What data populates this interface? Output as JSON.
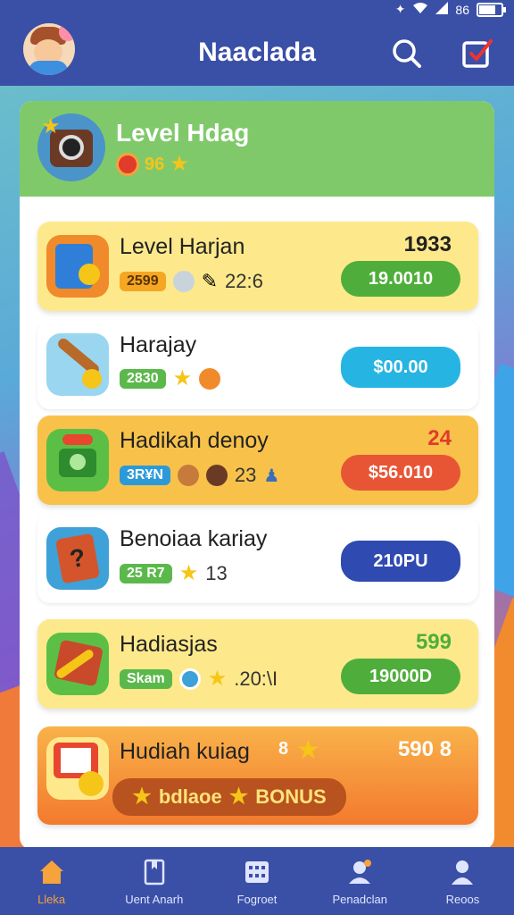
{
  "status": {
    "clock": "86",
    "battery_level": 0.8
  },
  "app": {
    "title": "Naaclada"
  },
  "header_card": {
    "title": "Level Hdag",
    "value": "96"
  },
  "rows": [
    {
      "title": "Level Harjan",
      "tag": "2599",
      "meta": "22:6",
      "extra": "1933",
      "button": "19.0010",
      "style": "yellow"
    },
    {
      "title": "Harajay",
      "tag": "2830",
      "meta": "",
      "extra": "",
      "button": "$00.00",
      "style": "white"
    },
    {
      "title": "Hadikah denoy",
      "tag": "3R¥N",
      "meta": "23",
      "extra": "24",
      "button": "$56.010",
      "style": "orange"
    },
    {
      "title": "Benoiaa kariay",
      "tag": "25 R7",
      "meta": "13",
      "extra": "",
      "button": "210PU",
      "style": "white"
    },
    {
      "title": "Hadiasjas",
      "tag": "Skam",
      "meta": ".20:\\I",
      "extra": "599",
      "button": "19000D",
      "style": "yellow"
    },
    {
      "title": "Hudiah kuiag",
      "tag": "8",
      "meta": "",
      "extra": "590 8",
      "button": "",
      "style": "orange-bonus"
    }
  ],
  "bonus": {
    "left_text": "bdlaoe",
    "right_text": "BONUS"
  },
  "nav": [
    {
      "label": "Lleka",
      "icon": "home-icon",
      "active": true
    },
    {
      "label": "Uent Anarh",
      "icon": "document-icon",
      "active": false
    },
    {
      "label": "Fogroet",
      "icon": "grid-icon",
      "active": false
    },
    {
      "label": "Penadclan",
      "icon": "user-badge-icon",
      "active": false
    },
    {
      "label": "Reoos",
      "icon": "profile-icon",
      "active": false
    }
  ]
}
